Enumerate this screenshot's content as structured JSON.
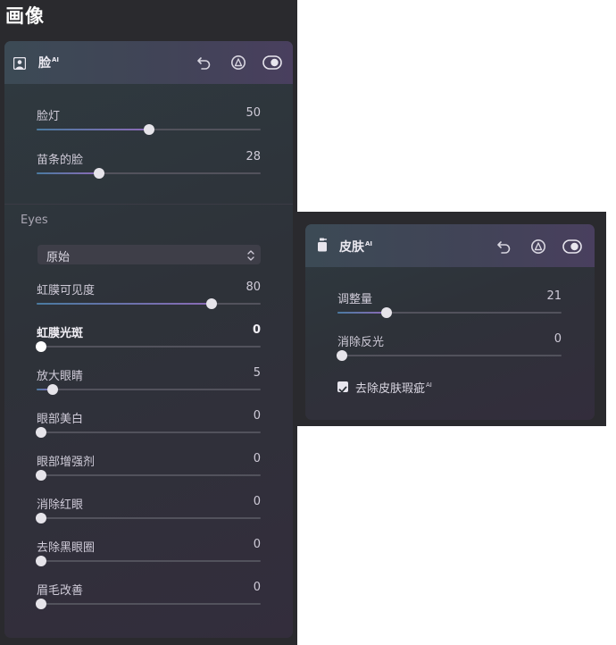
{
  "page_title": "画像",
  "face_panel": {
    "title": "脸",
    "ai_tag": "AI",
    "sliders_top": [
      {
        "label": "脸灯",
        "value": "50",
        "level": 0.5,
        "bold": false
      },
      {
        "label": "苗条的脸",
        "value": "28",
        "level": 0.28,
        "bold": false
      }
    ],
    "eyes": {
      "section_label": "Eyes",
      "preset": {
        "selected": "原始"
      },
      "sliders": [
        {
          "label": "虹膜可见度",
          "value": "80",
          "level": 0.8,
          "bold": false
        },
        {
          "label": "虹膜光斑",
          "value": "0",
          "level": 0,
          "bold": true
        },
        {
          "label": "放大眼睛",
          "value": "5",
          "level": 0.05,
          "bold": false
        },
        {
          "label": "眼部美白",
          "value": "0",
          "level": 0,
          "bold": false
        },
        {
          "label": "眼部增强剂",
          "value": "0",
          "level": 0,
          "bold": false
        },
        {
          "label": "消除红眼",
          "value": "0",
          "level": 0,
          "bold": false
        },
        {
          "label": "去除黑眼圈",
          "value": "0",
          "level": 0,
          "bold": false
        },
        {
          "label": "眉毛改善",
          "value": "0",
          "level": 0,
          "bold": false
        }
      ]
    }
  },
  "skin_panel": {
    "title": "皮肤",
    "ai_tag": "AI",
    "sliders": [
      {
        "label": "调整量",
        "value": "21",
        "level": 0.21,
        "bold": false
      },
      {
        "label": "消除反光",
        "value": "0",
        "level": 0,
        "bold": false
      }
    ],
    "checkbox": {
      "label": "去除皮肤瑕疵",
      "ai_tag": "AI",
      "checked": true
    }
  },
  "icons": {
    "face_panel_icon": "portrait-icon",
    "skin_panel_icon": "bottle-icon",
    "reset": "undo-icon",
    "mask": "mask-icon",
    "toggle": "toggle-icon"
  },
  "colors": {
    "panel_bg": "#2e3239",
    "header_accent": "#493f5e",
    "slider_fill_start": "#4a7aa0",
    "slider_fill_end": "#8c6ab6",
    "knob": "#e6e4ea"
  }
}
